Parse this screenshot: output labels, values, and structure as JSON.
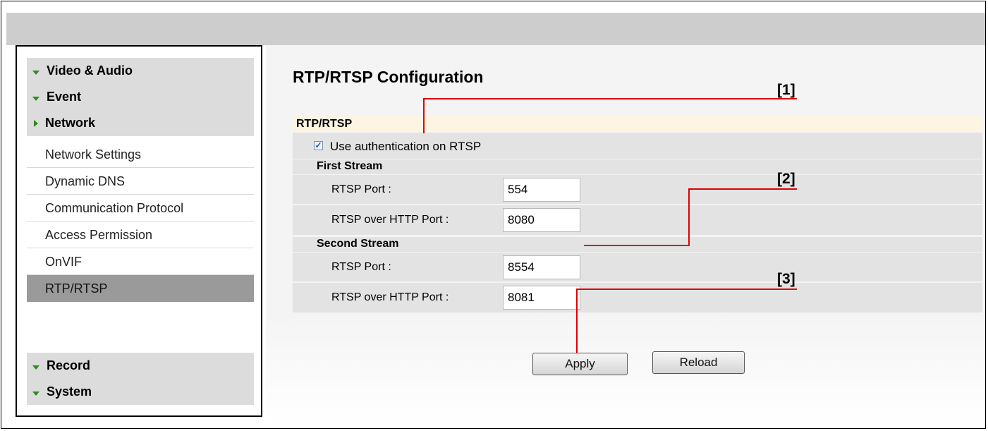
{
  "sidebar": {
    "top_categories": [
      {
        "label": "Video & Audio"
      },
      {
        "label": "Event"
      },
      {
        "label": "Network"
      }
    ],
    "network_items": [
      {
        "label": "Network Settings"
      },
      {
        "label": "Dynamic DNS"
      },
      {
        "label": "Communication Protocol"
      },
      {
        "label": "Access Permission"
      },
      {
        "label": "OnVIF"
      },
      {
        "label": "RTP/RTSP",
        "active": true
      }
    ],
    "bottom_categories": [
      {
        "label": "Record"
      },
      {
        "label": "System"
      }
    ]
  },
  "main": {
    "title": "RTP/RTSP Configuration",
    "section_title": "RTP/RTSP",
    "use_auth": {
      "label": "Use authentication on RTSP",
      "checked": true,
      "check_glyph": "✓"
    },
    "first_stream": {
      "title": "First Stream",
      "rtsp_port_label": "RTSP Port :",
      "rtsp_port_value": "554",
      "http_port_label": "RTSP over HTTP Port :",
      "http_port_value": "8080"
    },
    "second_stream": {
      "title": "Second Stream",
      "rtsp_port_label": "RTSP Port :",
      "rtsp_port_value": "8554",
      "http_port_label": "RTSP over HTTP Port :",
      "http_port_value": "8081"
    },
    "buttons": {
      "apply": "Apply",
      "reload": "Reload"
    }
  },
  "annotations": [
    {
      "label": "[1]"
    },
    {
      "label": "[2]"
    },
    {
      "label": "[3]"
    }
  ],
  "colors": {
    "header_bar": "#cdcdcd",
    "category_bg": "#dcdcdc",
    "active_item_bg": "#9a9a9a",
    "section_header_bg": "#fdf5e2",
    "row_bg": "#e3e3e3",
    "arrow_green": "#2e8b1e",
    "callout_red": "#e00000"
  }
}
